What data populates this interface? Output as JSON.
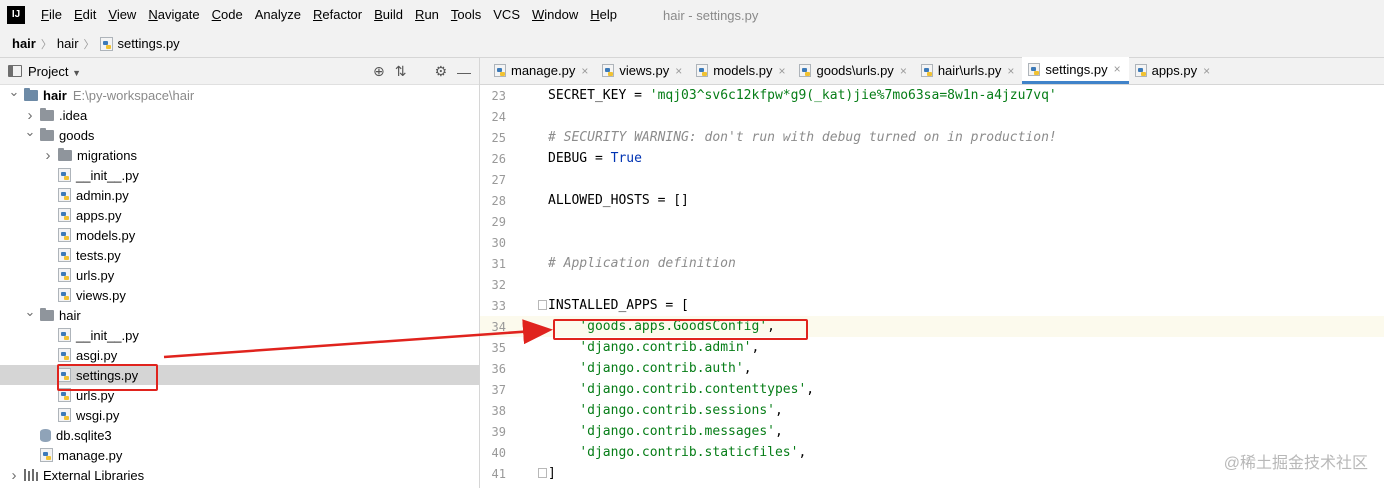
{
  "menubar": {
    "logo": "IJ",
    "items": [
      {
        "mn": "F",
        "rest": "ile"
      },
      {
        "mn": "E",
        "rest": "dit"
      },
      {
        "mn": "V",
        "rest": "iew"
      },
      {
        "mn": "N",
        "rest": "avigate"
      },
      {
        "mn": "C",
        "rest": "ode"
      },
      {
        "mn": "",
        "rest": "Analyze"
      },
      {
        "mn": "R",
        "rest": "efactor"
      },
      {
        "mn": "B",
        "rest": "uild"
      },
      {
        "mn": "R",
        "rest": "un"
      },
      {
        "mn": "T",
        "rest": "ools"
      },
      {
        "mn": "",
        "rest": "VCS"
      },
      {
        "mn": "W",
        "rest": "indow"
      },
      {
        "mn": "H",
        "rest": "elp"
      }
    ],
    "window_title": "hair - settings.py"
  },
  "breadcrumb": {
    "items": [
      "hair",
      "hair",
      "settings.py"
    ]
  },
  "project_panel": {
    "title": "Project",
    "tree": [
      {
        "label": "hair",
        "hint": "E:\\py-workspace\\hair",
        "icon": "root-folder",
        "expanded": true
      },
      {
        "label": ".idea",
        "icon": "folder",
        "expanded": false
      },
      {
        "label": "goods",
        "icon": "folder",
        "expanded": true
      },
      {
        "label": "migrations",
        "icon": "folder",
        "expanded": false
      },
      {
        "label": "__init__.py",
        "icon": "python-file"
      },
      {
        "label": "admin.py",
        "icon": "python-file"
      },
      {
        "label": "apps.py",
        "icon": "python-file"
      },
      {
        "label": "models.py",
        "icon": "python-file"
      },
      {
        "label": "tests.py",
        "icon": "python-file"
      },
      {
        "label": "urls.py",
        "icon": "python-file"
      },
      {
        "label": "views.py",
        "icon": "python-file"
      },
      {
        "label": "hair",
        "icon": "folder",
        "expanded": true
      },
      {
        "label": "__init__.py",
        "icon": "python-file"
      },
      {
        "label": "asgi.py",
        "icon": "python-file"
      },
      {
        "label": "settings.py",
        "icon": "python-file",
        "selected": true
      },
      {
        "label": "urls.py",
        "icon": "python-file"
      },
      {
        "label": "wsgi.py",
        "icon": "python-file"
      },
      {
        "label": "db.sqlite3",
        "icon": "database-file"
      },
      {
        "label": "manage.py",
        "icon": "python-file"
      },
      {
        "label": "External Libraries",
        "icon": "library-icon",
        "expanded": false
      }
    ]
  },
  "editor": {
    "tabs": [
      {
        "label": "manage.py",
        "active": false
      },
      {
        "label": "views.py",
        "active": false
      },
      {
        "label": "models.py",
        "active": false
      },
      {
        "label": "goods\\urls.py",
        "active": false
      },
      {
        "label": "hair\\urls.py",
        "active": false
      },
      {
        "label": "settings.py",
        "active": true
      },
      {
        "label": "apps.py",
        "active": false
      }
    ],
    "lines": [
      {
        "num": "23",
        "text": "SECRET_KEY = 'mqj03^sv6c12kfpw*g9(_kat)jie%7mo63sa=8w1n-a4jzu7vq'"
      },
      {
        "num": "24",
        "text": ""
      },
      {
        "num": "25",
        "text": "# SECURITY WARNING: don't run with debug turned on in production!"
      },
      {
        "num": "26",
        "text": "DEBUG = True"
      },
      {
        "num": "27",
        "text": ""
      },
      {
        "num": "28",
        "text": "ALLOWED_HOSTS = []"
      },
      {
        "num": "29",
        "text": ""
      },
      {
        "num": "30",
        "text": ""
      },
      {
        "num": "31",
        "text": "# Application definition"
      },
      {
        "num": "32",
        "text": ""
      },
      {
        "num": "33",
        "text": "INSTALLED_APPS = ["
      },
      {
        "num": "34",
        "text": "    'goods.apps.GoodsConfig',"
      },
      {
        "num": "35",
        "text": "    'django.contrib.admin',"
      },
      {
        "num": "36",
        "text": "    'django.contrib.auth',"
      },
      {
        "num": "37",
        "text": "    'django.contrib.contenttypes',"
      },
      {
        "num": "38",
        "text": "    'django.contrib.sessions',"
      },
      {
        "num": "39",
        "text": "    'django.contrib.messages',"
      },
      {
        "num": "40",
        "text": "    'django.contrib.staticfiles',"
      },
      {
        "num": "41",
        "text": "]"
      }
    ]
  },
  "watermark": "@稀土掘金技术社区",
  "colors": {
    "accent": "#4083c9",
    "annotation_red": "#e0231d",
    "string": "#067d17",
    "keyword": "#0033b3",
    "comment": "#8c8c8c"
  }
}
